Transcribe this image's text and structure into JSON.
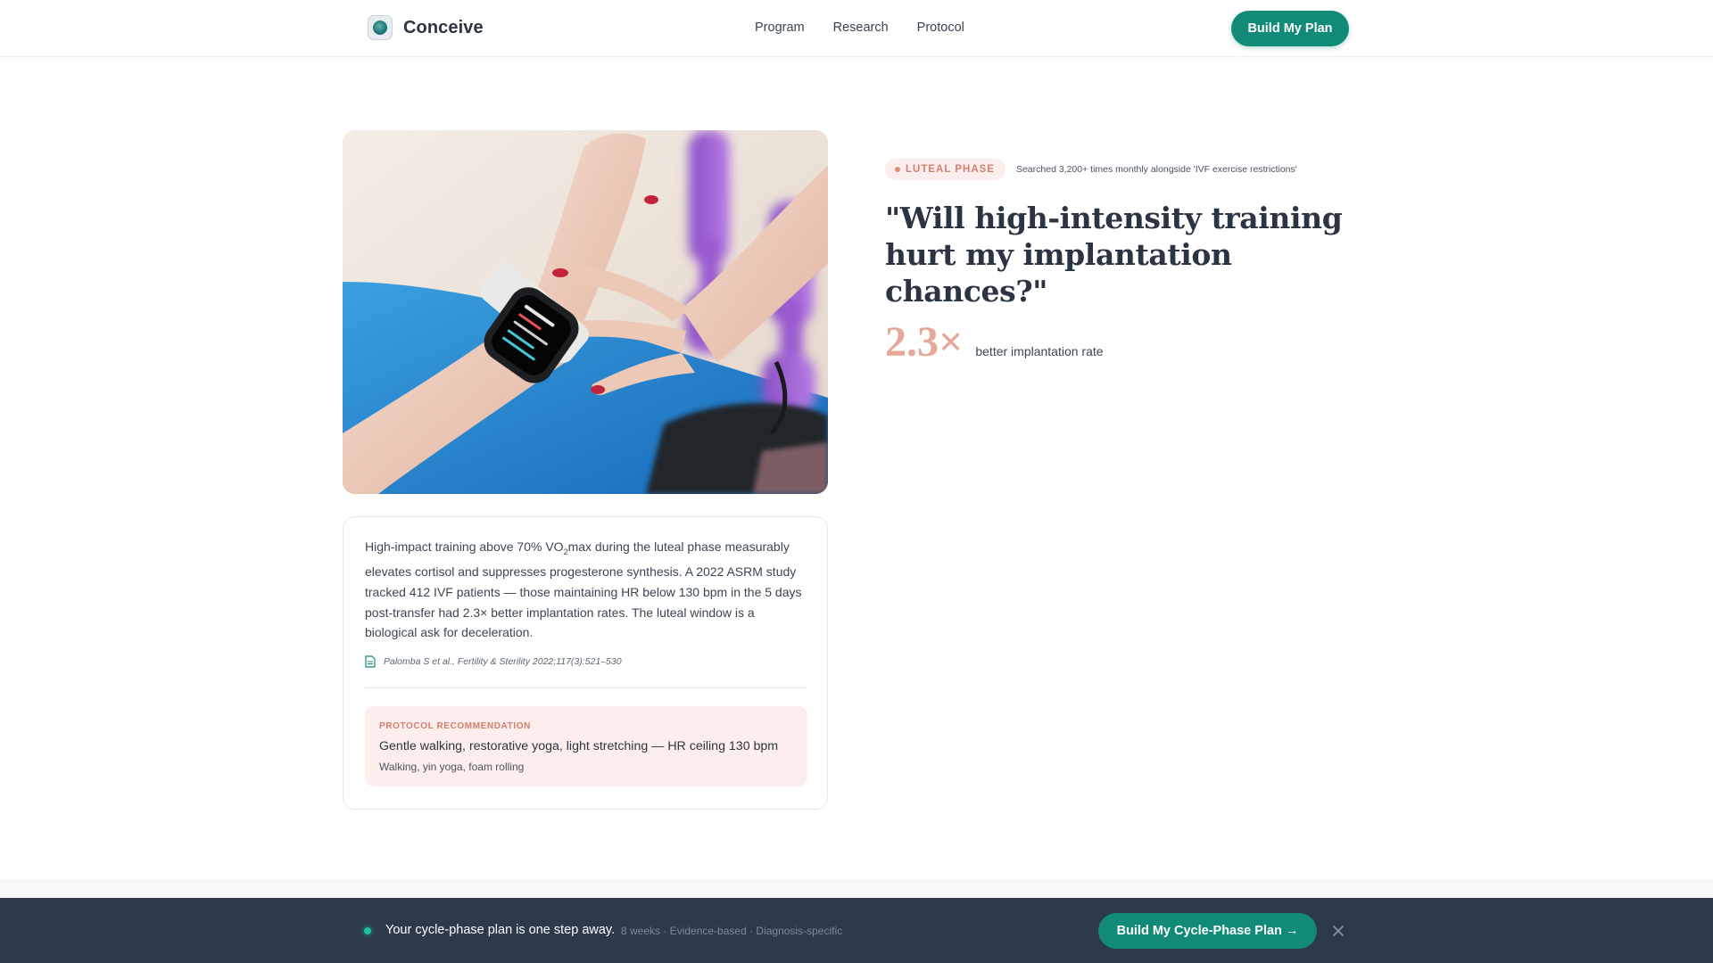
{
  "header": {
    "brand": "Conceive",
    "nav": [
      "Program",
      "Research",
      "Protocol"
    ],
    "cta_label": "Build My Plan"
  },
  "hero": {
    "image_icon": "smartwatch-wrist-photo"
  },
  "article": {
    "body_before_sub": "High-impact training above 70% VO",
    "body_sub": "2",
    "body_after_sub": "max during the luteal phase measurably elevates cortisol and suppresses progesterone synthesis. A 2022 ASRM study tracked 412 IVF patients — those maintaining HR below 130 bpm in the 5 days post-transfer had 2.3× better implantation rates. The luteal window is a biological ask for deceleration.",
    "citation": "Palomba S et al., Fertility & Sterility 2022;117(3):521–530",
    "recommendation": {
      "label": "PROTOCOL RECOMMENDATION",
      "title": "Gentle walking, restorative yoga, light stretching — HR ceiling 130 bpm",
      "subtitle": "Walking, yin yoga, foam rolling"
    }
  },
  "side": {
    "phase_badge": "LUTEAL PHASE",
    "phase_meta": "Searched 3,200+ times monthly alongside 'IVF exercise restrictions'",
    "headline": "\"Will high-intensity training hurt my implantation chances?\"",
    "stat_value": "2.3×",
    "stat_label": "better implantation rate"
  },
  "bottom_bar": {
    "message": "Your cycle-phase plan is one step away.",
    "meta": "8 weeks · Evidence-based · Diagnosis-specific",
    "cta_label": "Build My Cycle-Phase Plan →"
  },
  "colors": {
    "accent": "#128a78",
    "rose": "#d37f70",
    "rose_light": "#fbeeec",
    "stat": "#e4a998",
    "bar_bg": "#2c3a4b"
  }
}
